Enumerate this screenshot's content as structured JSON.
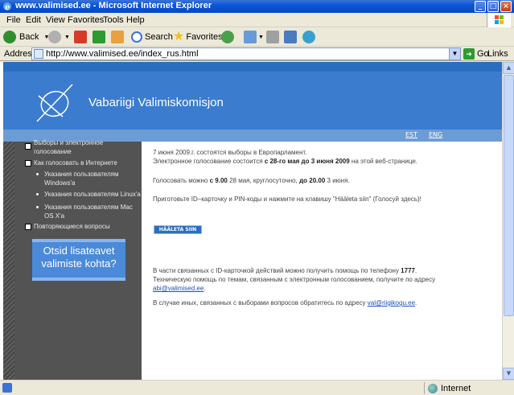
{
  "window": {
    "title": "www.valimised.ee - Microsoft Internet Explorer",
    "controls": {
      "minimize": "_",
      "maximize": "□",
      "close": "×"
    }
  },
  "menu": [
    "File",
    "Edit",
    "View",
    "Favorites",
    "Tools",
    "Help"
  ],
  "toolbar": {
    "back": "Back",
    "search": "Search",
    "favorites": "Favorites"
  },
  "address": {
    "label": "Address",
    "url": "http://www.valimised.ee/index_rus.html",
    "go": "Go",
    "links": "Links"
  },
  "site": {
    "title": "Vabariigi Valimiskomisjon",
    "languages": [
      "EST",
      "ENG"
    ]
  },
  "sidebar": {
    "items": [
      {
        "label": "Выборы и электронное голосование"
      },
      {
        "label": "Как голосовать в Интернете"
      }
    ],
    "subitems": [
      {
        "label": "Указания пользователям Windows'a"
      },
      {
        "label": "Указания пользователям Linux'a"
      },
      {
        "label": "Указания пользователям Mac OS X'a"
      }
    ],
    "faq": "Повторяющиеся вопросы",
    "promo": "Otsid lisateavet valimiste kohta?"
  },
  "main": {
    "p1_line1": "7 июня 2009.г. состоятся выборы в Европарламент.",
    "p1_line2_pre": "Электронное голосование состоится ",
    "p1_line2_bold": "с 28-го мая до 3 июня 2009",
    "p1_line2_post": " на этой веб-странице.",
    "p2_pre": "Голосовать можно ",
    "p2_bold1": "с 9.00",
    "p2_mid": " 28 мая, круглосуточно, ",
    "p2_bold2": "до 20.00",
    "p2_post": " 3 июня.",
    "p3": "Приготовьте ID–карточку и PIN-коды и нажмите на клавишу \"Hääleta siin\" (Голосуй здесь)!",
    "vote_button": "HÄÄLETA SIIN",
    "help1_pre": "В части связанных с ID-карточкой действий можно получить помощь по телефону ",
    "help1_bold": "1777",
    "help1_post": ".",
    "help2": "Техническую помощь по темам, связанным с электронным голосованием, получите по адресу ",
    "help2_link": "abi@valimised.ee",
    "help3": "В случае иных, связанных с выборами вопросов обратитесь по адресу ",
    "help3_link": "val@riigikogu.ee",
    "period": "."
  },
  "status": {
    "zone": "Internet"
  },
  "colors": {
    "banner": "#3b7ccf",
    "sidebar": "#535353",
    "title_bar": "#0a55d8"
  }
}
